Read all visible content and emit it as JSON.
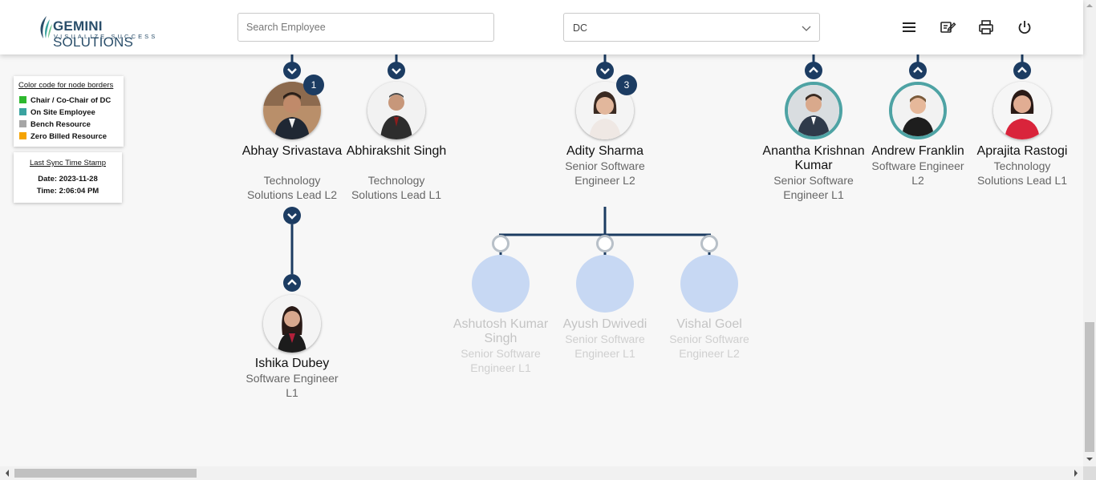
{
  "header": {
    "logo_brand_bold": "GEMINI",
    "logo_brand_rest": " SOLUTIONS",
    "logo_tagline": "VISUALIZE SUCCESS",
    "search_placeholder": "Search Employee",
    "dc_value": "DC",
    "icons": [
      "menu-icon",
      "edit-note-icon",
      "print-icon",
      "power-icon"
    ]
  },
  "legend": {
    "title": "Color code for node borders",
    "items": [
      {
        "label": "Chair / Co-Chair of DC",
        "color": "#2eb82e"
      },
      {
        "label": "On Site Employee",
        "color": "#3aa3a0"
      },
      {
        "label": "Bench Resource",
        "color": "#a6a6a6"
      },
      {
        "label": "Zero Billed Resource",
        "color": "#f5a300"
      }
    ]
  },
  "sync": {
    "title": "Last Sync Time Stamp",
    "date": "Date: 2023-11-28",
    "time": "Time: 2:06:04 PM"
  },
  "nodes": [
    {
      "name": "Abhay Srivastava",
      "role": "Technology Solutions Lead L2",
      "badge": "1",
      "border": "plain"
    },
    {
      "name": "Abhirakshit Singh",
      "role": "Technology Solutions Lead L1",
      "border": "plain"
    },
    {
      "name": "Adity Sharma",
      "role": "Senior Software Engineer L2",
      "badge": "3",
      "border": "plain"
    },
    {
      "name": "Anantha Krishnan Kumar",
      "role": "Senior Software Engineer L1",
      "border": "teal"
    },
    {
      "name": "Andrew Franklin",
      "role": "Software Engineer L2",
      "border": "teal"
    },
    {
      "name": "Aprajita Rastogi",
      "role": "Technology Solutions Lead L1",
      "border": "plain"
    },
    {
      "name": "Ishika Dubey",
      "role": "Software Engineer L1",
      "border": "plain"
    },
    {
      "name": "Ashutosh Kumar Singh",
      "role": "Senior Software Engineer L1",
      "ghost": true
    },
    {
      "name": "Ayush Dwivedi",
      "role": "Senior Software Engineer L1",
      "ghost": true
    },
    {
      "name": "Vishal Goel",
      "role": "Senior Software Engineer L2",
      "ghost": true
    }
  ]
}
